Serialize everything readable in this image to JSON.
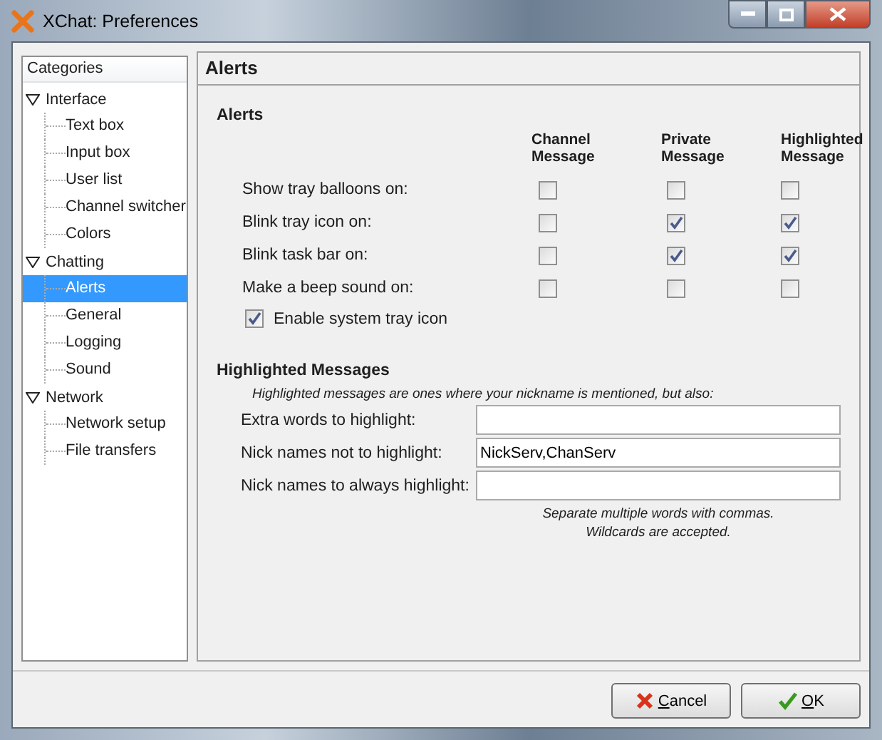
{
  "window": {
    "title": "XChat: Preferences"
  },
  "sidebar": {
    "header": "Categories",
    "items": [
      {
        "label": "Interface",
        "expanded": true,
        "children": [
          {
            "label": "Text box",
            "selected": false
          },
          {
            "label": "Input box",
            "selected": false
          },
          {
            "label": "User list",
            "selected": false
          },
          {
            "label": "Channel switcher",
            "selected": false
          },
          {
            "label": "Colors",
            "selected": false
          }
        ]
      },
      {
        "label": "Chatting",
        "expanded": true,
        "children": [
          {
            "label": "Alerts",
            "selected": true
          },
          {
            "label": "General",
            "selected": false
          },
          {
            "label": "Logging",
            "selected": false
          },
          {
            "label": "Sound",
            "selected": false
          }
        ]
      },
      {
        "label": "Network",
        "expanded": true,
        "children": [
          {
            "label": "Network setup",
            "selected": false
          },
          {
            "label": "File transfers",
            "selected": false
          }
        ]
      }
    ]
  },
  "page_title": "Alerts",
  "alerts": {
    "heading": "Alerts",
    "columns": [
      "Channel Message",
      "Private Message",
      "Highlighted Message"
    ],
    "rows": [
      {
        "label": "Show tray balloons on:",
        "checks": [
          false,
          false,
          false
        ]
      },
      {
        "label": "Blink tray icon on:",
        "checks": [
          false,
          true,
          true
        ]
      },
      {
        "label": "Blink task bar on:",
        "checks": [
          false,
          true,
          true
        ]
      },
      {
        "label": "Make a beep sound on:",
        "checks": [
          false,
          false,
          false
        ]
      }
    ],
    "tray": {
      "label": "Enable system tray icon",
      "checked": true
    }
  },
  "highlight": {
    "heading": "Highlighted Messages",
    "note": "Highlighted messages are ones where your nickname is mentioned, but also:",
    "fields": [
      {
        "label": "Extra words to highlight:"
      },
      {
        "label": "Nick names not to highlight:",
        "value": "NickServ,ChanServ"
      },
      {
        "label": "Nick names to always highlight:"
      }
    ],
    "hints": [
      "Separate multiple words with commas.",
      "Wildcards are accepted."
    ]
  },
  "buttons": [
    {
      "kind": "cancel",
      "label": "Cancel"
    },
    {
      "kind": "ok",
      "label": "OK"
    }
  ]
}
